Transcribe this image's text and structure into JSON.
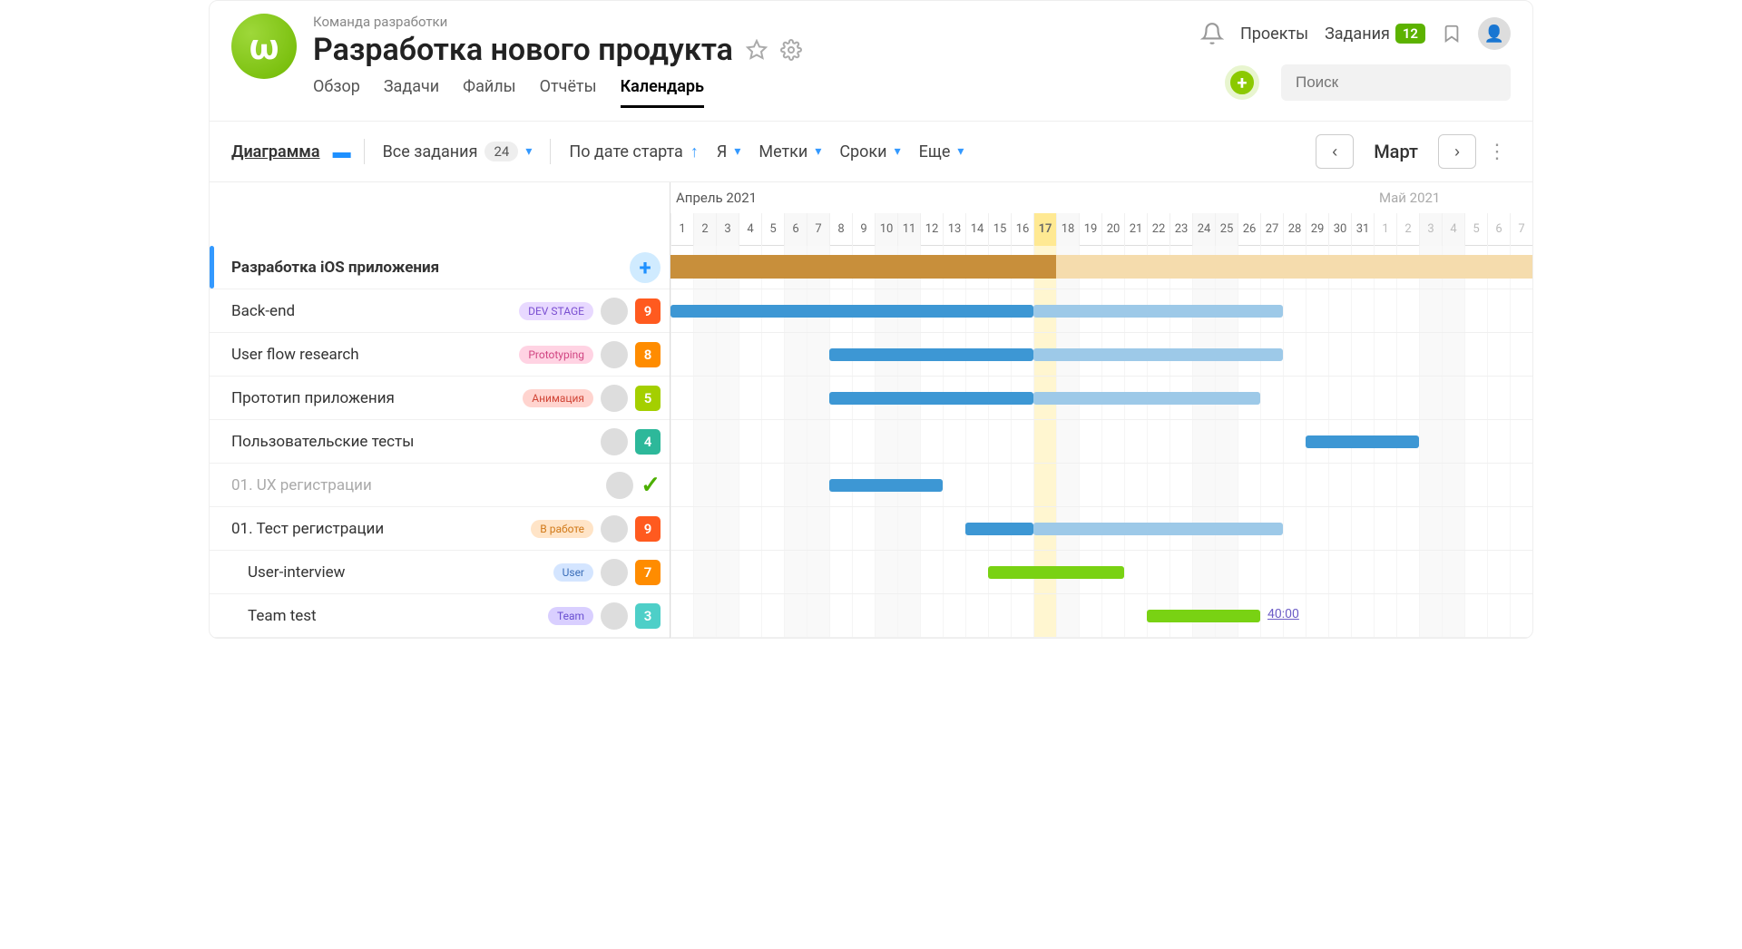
{
  "breadcrumb": "Команда разработки",
  "title": "Разработка нового продукта",
  "tabs": [
    "Обзор",
    "Задачи",
    "Файлы",
    "Отчёты",
    "Календарь"
  ],
  "activeTab": 4,
  "nav": {
    "projects": "Проекты",
    "tasks": "Задания",
    "tasksCount": "12"
  },
  "search": {
    "placeholder": "Поиск"
  },
  "toolbar": {
    "view": "Диаграмма",
    "filterAll": "Все задания",
    "filterCount": "24",
    "sort": "По дате старта",
    "me": "Я",
    "tags": "Метки",
    "dates": "Сроки",
    "more": "Еще",
    "month": "Март"
  },
  "timeline": {
    "month1": "Апрель 2021",
    "month2": "Май 2021",
    "days": [
      {
        "d": "1"
      },
      {
        "d": "2",
        "w": true
      },
      {
        "d": "3",
        "w": true
      },
      {
        "d": "4"
      },
      {
        "d": "5"
      },
      {
        "d": "6",
        "w": true
      },
      {
        "d": "7",
        "w": true
      },
      {
        "d": "8"
      },
      {
        "d": "9"
      },
      {
        "d": "10",
        "w": true
      },
      {
        "d": "11",
        "w": true
      },
      {
        "d": "12"
      },
      {
        "d": "13"
      },
      {
        "d": "14"
      },
      {
        "d": "15"
      },
      {
        "d": "16"
      },
      {
        "d": "17",
        "today": true
      },
      {
        "d": "18",
        "w": true
      },
      {
        "d": "19"
      },
      {
        "d": "20"
      },
      {
        "d": "21"
      },
      {
        "d": "22"
      },
      {
        "d": "23"
      },
      {
        "d": "24",
        "w": true
      },
      {
        "d": "25",
        "w": true
      },
      {
        "d": "26"
      },
      {
        "d": "27"
      },
      {
        "d": "28"
      },
      {
        "d": "29"
      },
      {
        "d": "30"
      },
      {
        "d": "31"
      },
      {
        "d": "1",
        "f": true
      },
      {
        "d": "2",
        "f": true
      },
      {
        "d": "3",
        "f": true,
        "w": true
      },
      {
        "d": "4",
        "f": true,
        "w": true
      },
      {
        "d": "5",
        "f": true
      },
      {
        "d": "6",
        "f": true
      },
      {
        "d": "7",
        "f": true
      }
    ]
  },
  "group": {
    "name": "Разработка iOS приложения",
    "progressDays": 17,
    "totalStartDay": 1
  },
  "tasks": [
    {
      "name": "Back-end",
      "tag": "DEV STAGE",
      "tagClass": "tag-purple",
      "priority": "9",
      "pClass": "p-red",
      "startDay": 1,
      "barSolidDays": 16,
      "barLightDays": 11
    },
    {
      "name": "User flow research",
      "tag": "Prototyping",
      "tagClass": "tag-pink",
      "priority": "8",
      "pClass": "p-orange",
      "startDay": 8,
      "barSolidDays": 9,
      "barLightDays": 11
    },
    {
      "name": "Прототип приложения",
      "tag": "Анимация",
      "tagClass": "tag-red",
      "priority": "5",
      "pClass": "p-lime",
      "startDay": 8,
      "barSolidDays": 9,
      "barLightDays": 10,
      "depToNext": true
    },
    {
      "name": "Пользовательские тесты",
      "tag": null,
      "priority": "4",
      "pClass": "p-green",
      "startDay": 29,
      "barSolidDays": 5,
      "barLightDays": 0,
      "depArrowIn": true
    },
    {
      "name": "01. UX регистрации",
      "tag": null,
      "done": true,
      "startDay": 8,
      "barSolidDays": 5,
      "barLightDays": 0
    },
    {
      "name": "01. Тест регистрации",
      "tag": "В работе",
      "tagClass": "tag-orange",
      "priority": "9",
      "pClass": "p-red",
      "startDay": 14,
      "barSolidDays": 3,
      "barLightDays": 11
    },
    {
      "name": "User-interview",
      "tag": "User",
      "tagClass": "tag-blue",
      "priority": "7",
      "pClass": "p-orange",
      "indent": true,
      "startDay": 15,
      "barSolidDays": 6,
      "barLightDays": 0,
      "barColor": "green"
    },
    {
      "name": "Team test",
      "tag": "Team",
      "tagClass": "tag-violet",
      "priority": "3",
      "pClass": "p-teal",
      "indent": true,
      "startDay": 22,
      "barSolidDays": 5,
      "barLightDays": 0,
      "barColor": "green",
      "duration": "40:00"
    }
  ]
}
